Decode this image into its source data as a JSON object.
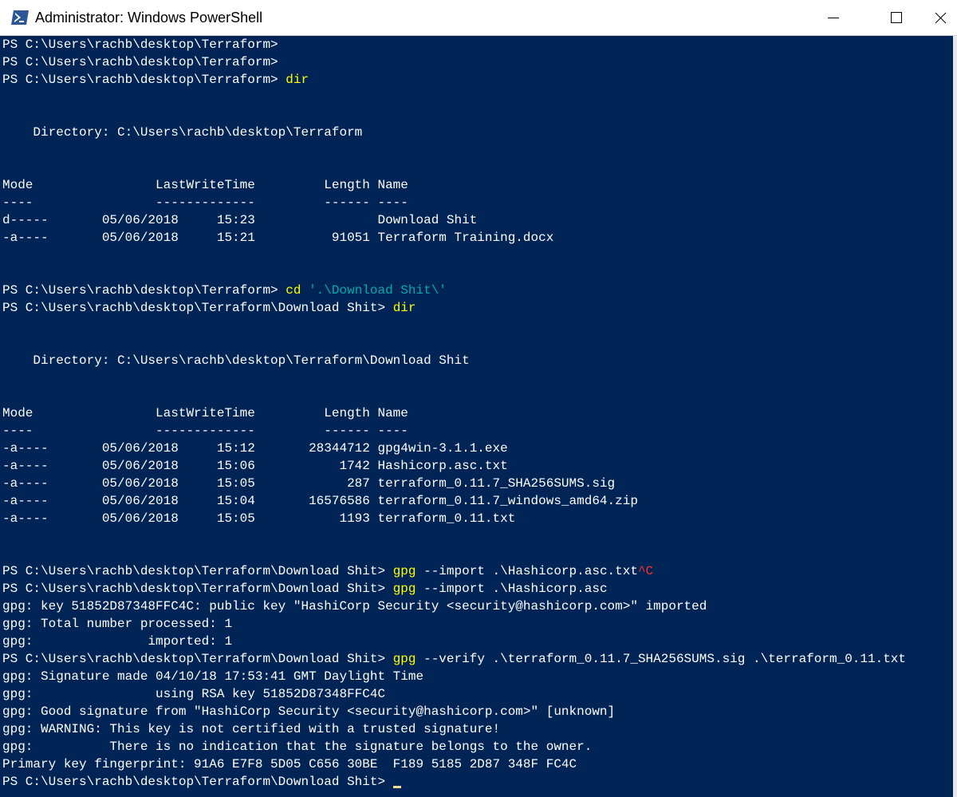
{
  "window": {
    "title": "Administrator: Windows PowerShell"
  },
  "icons": {
    "app": "powershell-icon",
    "minimize": "minimize-icon",
    "maximize": "maximize-icon",
    "close": "close-icon"
  },
  "colors": {
    "console_bg": "#012456",
    "text": "#ffffff",
    "command": "#ffff00",
    "string": "#00aaaa",
    "ctrl_c": "#ff3030"
  },
  "console": {
    "lines": [
      [
        {
          "t": "PS C:\\Users\\rachb\\desktop\\Terraform>"
        }
      ],
      [
        {
          "t": "PS C:\\Users\\rachb\\desktop\\Terraform>"
        }
      ],
      [
        {
          "t": "PS C:\\Users\\rachb\\desktop\\Terraform> "
        },
        {
          "t": "dir",
          "c": "cmd"
        }
      ],
      [],
      [],
      [
        {
          "t": "    Directory: C:\\Users\\rachb\\desktop\\Terraform"
        }
      ],
      [],
      [],
      [
        {
          "t": "Mode                LastWriteTime         Length Name"
        }
      ],
      [
        {
          "t": "----                -------------         ------ ----"
        }
      ],
      [
        {
          "t": "d-----       05/06/2018     15:23                Download Shit"
        }
      ],
      [
        {
          "t": "-a----       05/06/2018     15:21          91051 Terraform Training.docx"
        }
      ],
      [],
      [],
      [
        {
          "t": "PS C:\\Users\\rachb\\desktop\\Terraform> "
        },
        {
          "t": "cd",
          "c": "cmd"
        },
        {
          "t": " "
        },
        {
          "t": "'.\\Download Shit\\'",
          "c": "str"
        }
      ],
      [
        {
          "t": "PS C:\\Users\\rachb\\desktop\\Terraform\\Download Shit> "
        },
        {
          "t": "dir",
          "c": "cmd"
        }
      ],
      [],
      [],
      [
        {
          "t": "    Directory: C:\\Users\\rachb\\desktop\\Terraform\\Download Shit"
        }
      ],
      [],
      [],
      [
        {
          "t": "Mode                LastWriteTime         Length Name"
        }
      ],
      [
        {
          "t": "----                -------------         ------ ----"
        }
      ],
      [
        {
          "t": "-a----       05/06/2018     15:12       28344712 gpg4win-3.1.1.exe"
        }
      ],
      [
        {
          "t": "-a----       05/06/2018     15:06           1742 Hashicorp.asc.txt"
        }
      ],
      [
        {
          "t": "-a----       05/06/2018     15:05            287 terraform_0.11.7_SHA256SUMS.sig"
        }
      ],
      [
        {
          "t": "-a----       05/06/2018     15:04       16576586 terraform_0.11.7_windows_amd64.zip"
        }
      ],
      [
        {
          "t": "-a----       05/06/2018     15:05           1193 terraform_0.11.txt"
        }
      ],
      [],
      [],
      [
        {
          "t": "PS C:\\Users\\rachb\\desktop\\Terraform\\Download Shit> "
        },
        {
          "t": "gpg",
          "c": "cmd"
        },
        {
          "t": " --import .\\Hashicorp.asc.txt"
        },
        {
          "t": "^C",
          "c": "ctl"
        }
      ],
      [
        {
          "t": "PS C:\\Users\\rachb\\desktop\\Terraform\\Download Shit> "
        },
        {
          "t": "gpg",
          "c": "cmd"
        },
        {
          "t": " --import .\\Hashicorp.asc"
        }
      ],
      [
        {
          "t": "gpg: key 51852D87348FFC4C: public key \"HashiCorp Security <security@hashicorp.com>\" imported"
        }
      ],
      [
        {
          "t": "gpg: Total number processed: 1"
        }
      ],
      [
        {
          "t": "gpg:               imported: 1"
        }
      ],
      [
        {
          "t": "PS C:\\Users\\rachb\\desktop\\Terraform\\Download Shit> "
        },
        {
          "t": "gpg",
          "c": "cmd"
        },
        {
          "t": " --verify .\\terraform_0.11.7_SHA256SUMS.sig .\\terraform_0.11.txt"
        }
      ],
      [
        {
          "t": "gpg: Signature made 04/10/18 17:53:41 GMT Daylight Time"
        }
      ],
      [
        {
          "t": "gpg:                using RSA key 51852D87348FFC4C"
        }
      ],
      [
        {
          "t": "gpg: Good signature from \"HashiCorp Security <security@hashicorp.com>\" [unknown]"
        }
      ],
      [
        {
          "t": "gpg: WARNING: This key is not certified with a trusted signature!"
        }
      ],
      [
        {
          "t": "gpg:          There is no indication that the signature belongs to the owner."
        }
      ],
      [
        {
          "t": "Primary key fingerprint: 91A6 E7F8 5D05 C656 30BE  F189 5185 2D87 348F FC4C"
        }
      ],
      [
        {
          "t": "PS C:\\Users\\rachb\\desktop\\Terraform\\Download Shit> "
        },
        {
          "cursor": true
        }
      ]
    ]
  }
}
